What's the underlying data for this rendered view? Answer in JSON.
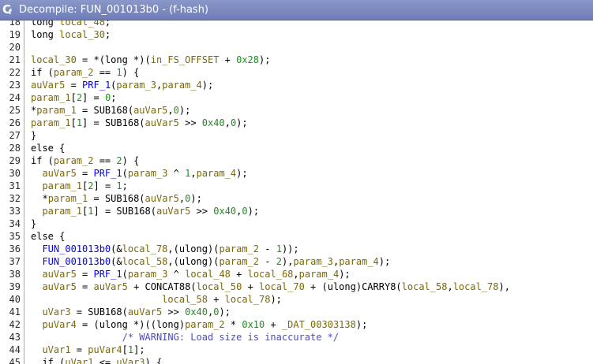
{
  "window": {
    "title": "Decompile: FUN_001013b0 -  (f-hash)"
  },
  "colors": {
    "titlebar": "#7b88bf",
    "variable": "#7b6a00",
    "number": "#1f8f1f",
    "function": "#0000ff",
    "comment": "#4a4ad0"
  },
  "lines": [
    {
      "n": "18",
      "t": [
        [
          "",
          "  long "
        ],
        [
          "var",
          "local_48"
        ],
        [
          "",
          ";"
        ]
      ]
    },
    {
      "n": "19",
      "t": [
        [
          "",
          "  long "
        ],
        [
          "var",
          "local_30"
        ],
        [
          "",
          ";"
        ]
      ]
    },
    {
      "n": "20",
      "t": []
    },
    {
      "n": "21",
      "t": [
        [
          "var",
          "  local_30"
        ],
        [
          "",
          " = *(long *)("
        ],
        [
          "var",
          "in_FS_OFFSET"
        ],
        [
          "",
          " + "
        ],
        [
          "num",
          "0x28"
        ],
        [
          "",
          ");"
        ]
      ]
    },
    {
      "n": "22",
      "t": [
        [
          "",
          "  if ("
        ],
        [
          "var",
          "param_2"
        ],
        [
          "",
          " == "
        ],
        [
          "num",
          "1"
        ],
        [
          "",
          ") {"
        ]
      ]
    },
    {
      "n": "23",
      "t": [
        [
          "var",
          "    auVar5"
        ],
        [
          "",
          " = "
        ],
        [
          "fn",
          "PRF_1"
        ],
        [
          "",
          "("
        ],
        [
          "var",
          "param_3"
        ],
        [
          "",
          ","
        ],
        [
          "var",
          "param_4"
        ],
        [
          "",
          ");"
        ]
      ]
    },
    {
      "n": "24",
      "t": [
        [
          "var",
          "    param_1"
        ],
        [
          "",
          "["
        ],
        [
          "num",
          "2"
        ],
        [
          "",
          "] = "
        ],
        [
          "num",
          "0"
        ],
        [
          "",
          ";"
        ]
      ]
    },
    {
      "n": "25",
      "t": [
        [
          "",
          "    *"
        ],
        [
          "var",
          "param_1"
        ],
        [
          "",
          " = SUB168("
        ],
        [
          "var",
          "auVar5"
        ],
        [
          "",
          ","
        ],
        [
          "num",
          "0"
        ],
        [
          "",
          ");"
        ]
      ]
    },
    {
      "n": "26",
      "t": [
        [
          "var",
          "    param_1"
        ],
        [
          "",
          "["
        ],
        [
          "num",
          "1"
        ],
        [
          "",
          "] = SUB168("
        ],
        [
          "var",
          "auVar5"
        ],
        [
          "",
          " >> "
        ],
        [
          "num",
          "0x40"
        ],
        [
          "",
          ","
        ],
        [
          "num",
          "0"
        ],
        [
          "",
          ");"
        ]
      ]
    },
    {
      "n": "27",
      "t": [
        [
          "",
          "  }"
        ]
      ]
    },
    {
      "n": "28",
      "t": [
        [
          "",
          "  else {"
        ]
      ]
    },
    {
      "n": "29",
      "t": [
        [
          "",
          "    if ("
        ],
        [
          "var",
          "param_2"
        ],
        [
          "",
          " == "
        ],
        [
          "num",
          "2"
        ],
        [
          "",
          ") {"
        ]
      ]
    },
    {
      "n": "30",
      "t": [
        [
          "var",
          "      auVar5"
        ],
        [
          "",
          " = "
        ],
        [
          "fn",
          "PRF_1"
        ],
        [
          "",
          "("
        ],
        [
          "var",
          "param_3"
        ],
        [
          "",
          " ^ "
        ],
        [
          "num",
          "1"
        ],
        [
          "",
          ","
        ],
        [
          "var",
          "param_4"
        ],
        [
          "",
          ");"
        ]
      ]
    },
    {
      "n": "31",
      "t": [
        [
          "var",
          "      param_1"
        ],
        [
          "",
          "["
        ],
        [
          "num",
          "2"
        ],
        [
          "",
          "] = "
        ],
        [
          "num",
          "1"
        ],
        [
          "",
          ";"
        ]
      ]
    },
    {
      "n": "32",
      "t": [
        [
          "",
          "      *"
        ],
        [
          "var",
          "param_1"
        ],
        [
          "",
          " = SUB168("
        ],
        [
          "var",
          "auVar5"
        ],
        [
          "",
          ","
        ],
        [
          "num",
          "0"
        ],
        [
          "",
          ");"
        ]
      ]
    },
    {
      "n": "33",
      "t": [
        [
          "var",
          "      param_1"
        ],
        [
          "",
          "["
        ],
        [
          "num",
          "1"
        ],
        [
          "",
          "] = SUB168("
        ],
        [
          "var",
          "auVar5"
        ],
        [
          "",
          " >> "
        ],
        [
          "num",
          "0x40"
        ],
        [
          "",
          ","
        ],
        [
          "num",
          "0"
        ],
        [
          "",
          ");"
        ]
      ]
    },
    {
      "n": "34",
      "t": [
        [
          "",
          "    }"
        ]
      ]
    },
    {
      "n": "35",
      "t": [
        [
          "",
          "    else {"
        ]
      ]
    },
    {
      "n": "36",
      "t": [
        [
          "fn",
          "      FUN_001013b0"
        ],
        [
          "",
          "(&"
        ],
        [
          "var",
          "local_78"
        ],
        [
          "",
          ",(ulong)("
        ],
        [
          "var",
          "param_2"
        ],
        [
          "",
          " - "
        ],
        [
          "num",
          "1"
        ],
        [
          "",
          "));"
        ]
      ]
    },
    {
      "n": "37",
      "t": [
        [
          "fn",
          "      FUN_001013b0"
        ],
        [
          "",
          "(&"
        ],
        [
          "var",
          "local_58"
        ],
        [
          "",
          ",(ulong)("
        ],
        [
          "var",
          "param_2"
        ],
        [
          "",
          " - "
        ],
        [
          "num",
          "2"
        ],
        [
          "",
          "),"
        ],
        [
          "var",
          "param_3"
        ],
        [
          "",
          ","
        ],
        [
          "var",
          "param_4"
        ],
        [
          "",
          ");"
        ]
      ]
    },
    {
      "n": "38",
      "t": [
        [
          "var",
          "      auVar5"
        ],
        [
          "",
          " = "
        ],
        [
          "fn",
          "PRF_1"
        ],
        [
          "",
          "("
        ],
        [
          "var",
          "param_3"
        ],
        [
          "",
          " ^ "
        ],
        [
          "var",
          "local_48"
        ],
        [
          "",
          " + "
        ],
        [
          "var",
          "local_68"
        ],
        [
          "",
          ","
        ],
        [
          "var",
          "param_4"
        ],
        [
          "",
          ");"
        ]
      ]
    },
    {
      "n": "39",
      "t": [
        [
          "var",
          "      auVar5"
        ],
        [
          "",
          " = "
        ],
        [
          "var",
          "auVar5"
        ],
        [
          "",
          " + CONCAT88("
        ],
        [
          "var",
          "local_50"
        ],
        [
          "",
          " + "
        ],
        [
          "var",
          "local_70"
        ],
        [
          "",
          " + (ulong)CARRY8("
        ],
        [
          "var",
          "local_58"
        ],
        [
          "",
          ","
        ],
        [
          "var",
          "local_78"
        ],
        [
          "",
          "),"
        ]
      ]
    },
    {
      "n": "40",
      "t": [
        [
          "",
          "                           "
        ],
        [
          "var",
          "local_58"
        ],
        [
          "",
          " + "
        ],
        [
          "var",
          "local_78"
        ],
        [
          "",
          ");"
        ]
      ]
    },
    {
      "n": "41",
      "t": [
        [
          "var",
          "      uVar3"
        ],
        [
          "",
          " = SUB168("
        ],
        [
          "var",
          "auVar5"
        ],
        [
          "",
          " >> "
        ],
        [
          "num",
          "0x40"
        ],
        [
          "",
          ","
        ],
        [
          "num",
          "0"
        ],
        [
          "",
          ");"
        ]
      ]
    },
    {
      "n": "42",
      "t": [
        [
          "var",
          "      puVar4"
        ],
        [
          "",
          " = (ulong *)((long)"
        ],
        [
          "var",
          "param_2"
        ],
        [
          "",
          " * "
        ],
        [
          "num",
          "0x10"
        ],
        [
          "",
          " + "
        ],
        [
          "var",
          "_DAT_00303138"
        ],
        [
          "",
          ");"
        ]
      ]
    },
    {
      "n": "43",
      "t": [
        [
          "cm",
          "                    /* WARNING: Load size is inaccurate */"
        ]
      ]
    },
    {
      "n": "44",
      "t": [
        [
          "var",
          "      uVar1"
        ],
        [
          "",
          " = "
        ],
        [
          "var",
          "puVar4"
        ],
        [
          "",
          "["
        ],
        [
          "num",
          "1"
        ],
        [
          "",
          "];"
        ]
      ]
    },
    {
      "n": "45",
      "t": [
        [
          "",
          "      if ("
        ],
        [
          "var",
          "uVar1"
        ],
        [
          "",
          " <= "
        ],
        [
          "var",
          "uVar3"
        ],
        [
          "",
          ") {"
        ]
      ]
    }
  ]
}
